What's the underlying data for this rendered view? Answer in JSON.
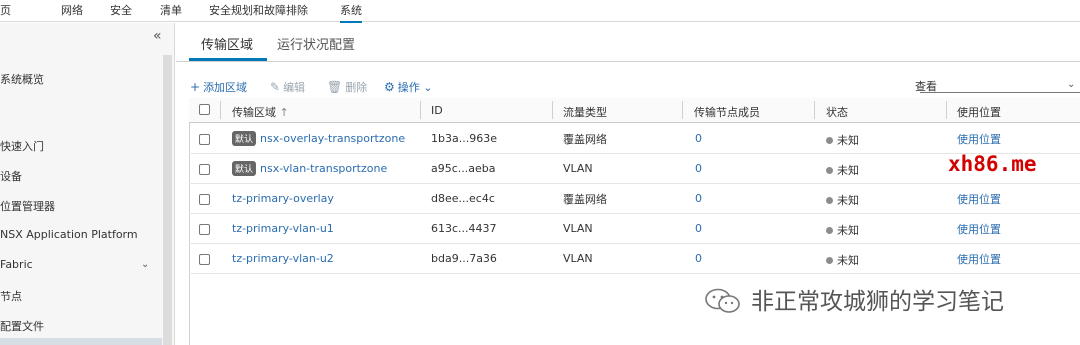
{
  "topnav": {
    "items": [
      "页",
      "网络",
      "安全",
      "清单",
      "安全规划和故障排除",
      "系统"
    ],
    "active": "系统"
  },
  "sidebar": {
    "collapse_icon": "double-chevron-left-icon",
    "items": [
      "系统概览",
      "快速入门",
      "设备",
      "位置管理器",
      "NSX Application Platform",
      "Fabric",
      "节点",
      "配置文件"
    ]
  },
  "tabs": [
    "传输区域",
    "运行状况配置"
  ],
  "toolbar": {
    "add": "添加区域",
    "edit": "编辑",
    "delete": "删除",
    "actions": "操作",
    "view_label": "查看"
  },
  "table": {
    "columns": [
      "传输区域",
      "ID",
      "流量类型",
      "传输节点成员",
      "状态",
      "使用位置"
    ],
    "sort_indicator": "↑",
    "default_badge": "默认",
    "rows": [
      {
        "default": true,
        "name": "nsx-overlay-transportzone",
        "id": "1b3a...963e",
        "traffic": "覆盖网络",
        "members": "0",
        "status": "未知",
        "usage": "使用位置"
      },
      {
        "default": true,
        "name": "nsx-vlan-transportzone",
        "id": "a95c...aeba",
        "traffic": "VLAN",
        "members": "0",
        "status": "未知",
        "usage": ""
      },
      {
        "default": false,
        "name": "tz-primary-overlay",
        "id": "d8ee...ec4c",
        "traffic": "覆盖网络",
        "members": "0",
        "status": "未知",
        "usage": "使用位置"
      },
      {
        "default": false,
        "name": "tz-primary-vlan-u1",
        "id": "613c...4437",
        "traffic": "VLAN",
        "members": "0",
        "status": "未知",
        "usage": "使用位置"
      },
      {
        "default": false,
        "name": "tz-primary-vlan-u2",
        "id": "bda9...7a36",
        "traffic": "VLAN",
        "members": "0",
        "status": "未知",
        "usage": "使用位置"
      }
    ]
  },
  "watermarks": {
    "site": "xh86.me",
    "wechat": "非正常攻城狮的学习笔记"
  }
}
